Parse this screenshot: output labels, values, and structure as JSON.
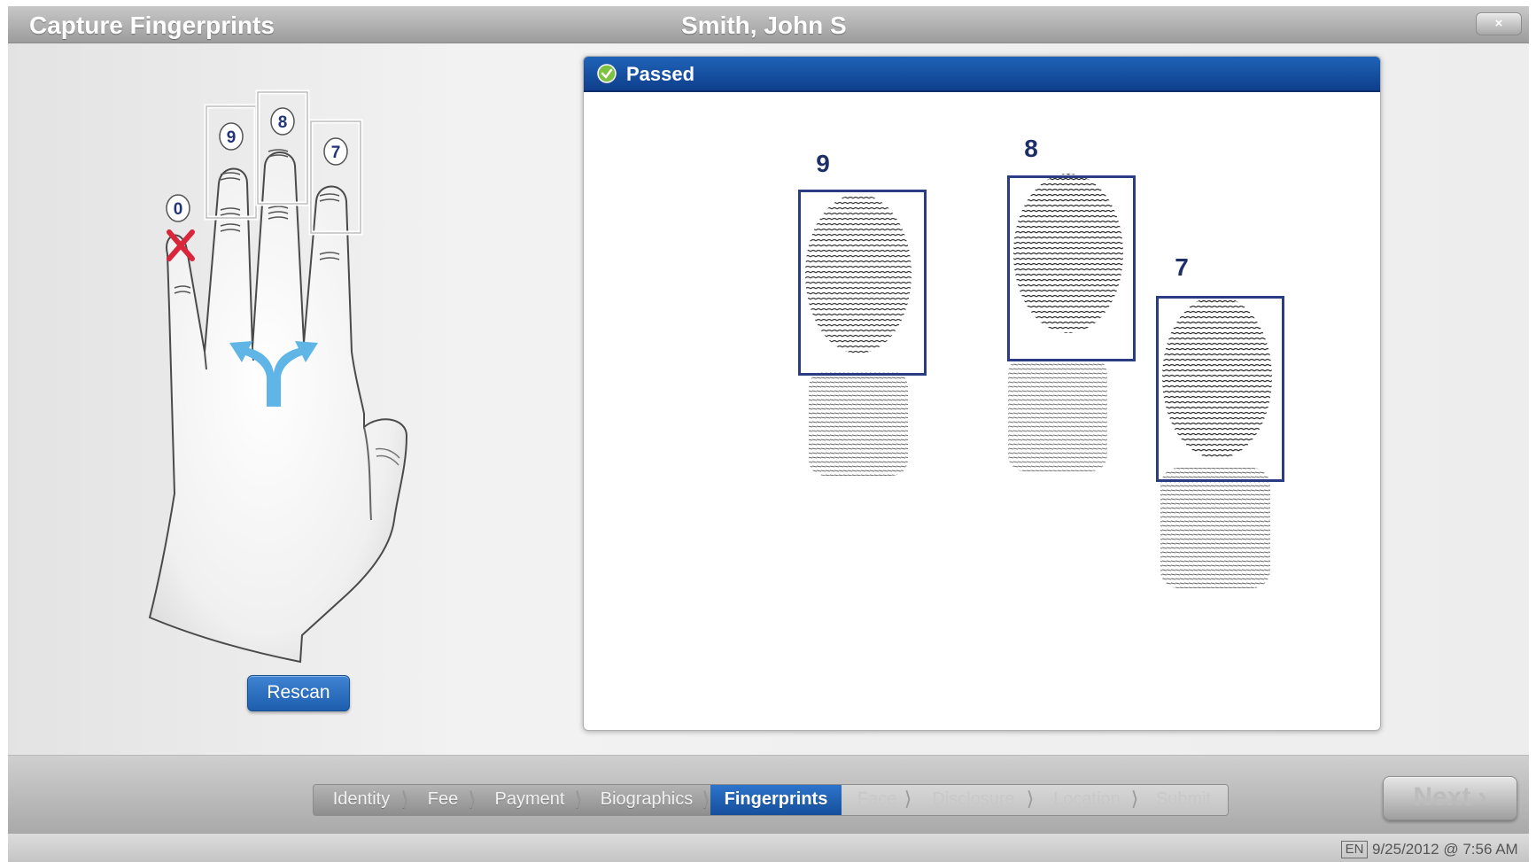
{
  "window": {
    "title": "Capture Fingerprints",
    "person_name": "Smith, John S",
    "close_label": "×"
  },
  "hand": {
    "fingers": [
      {
        "number": "0",
        "status": "missing"
      },
      {
        "number": "9",
        "status": "selected"
      },
      {
        "number": "8",
        "status": "selected"
      },
      {
        "number": "7",
        "status": "selected"
      }
    ],
    "center_icon": "split-arrow-icon",
    "missing_icon": "x-mark-icon"
  },
  "rescan_label": "Rescan",
  "result": {
    "status": "Passed",
    "status_icon": "check-circle-icon",
    "prints": [
      {
        "number": "9"
      },
      {
        "number": "8"
      },
      {
        "number": "7"
      }
    ]
  },
  "steps": [
    {
      "label": "Identity",
      "state": "done"
    },
    {
      "label": "Fee",
      "state": "done"
    },
    {
      "label": "Payment",
      "state": "done"
    },
    {
      "label": "Biographics",
      "state": "done"
    },
    {
      "label": "Fingerprints",
      "state": "active"
    },
    {
      "label": "Face",
      "state": "future"
    },
    {
      "label": "Disclosure",
      "state": "future"
    },
    {
      "label": "Location",
      "state": "future"
    },
    {
      "label": "Submit",
      "state": "future"
    }
  ],
  "next_label": "Next ›",
  "status_bar": {
    "language": "EN",
    "datetime": "9/25/2012 @ 7:56 AM"
  },
  "colors": {
    "accent_blue": "#1d5fae",
    "header_blue": "#0f3f8c",
    "frame_blue": "#2a3d84",
    "missing_red": "#d9263b",
    "arrow_blue": "#5fb5e6"
  }
}
